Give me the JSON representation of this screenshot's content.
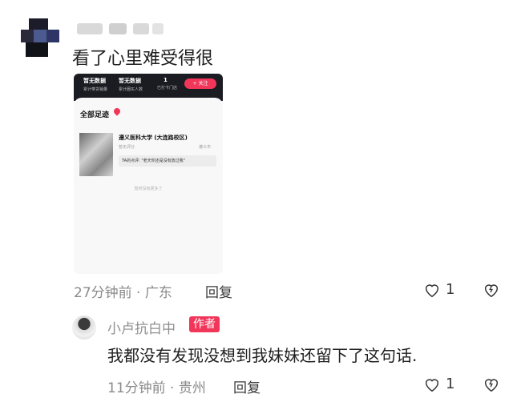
{
  "comment": {
    "text": "看了心里难受得很",
    "time_location": "27分钟前 · 广东",
    "reply_label": "回复",
    "like_count": "1"
  },
  "screenshot": {
    "stats": [
      {
        "value": "暂无数据",
        "label": "累计带货销量"
      },
      {
        "value": "暂无数据",
        "label": "累计圈买人数"
      },
      {
        "value": "1",
        "label": "已打卡门店"
      }
    ],
    "follow_label": "+ 关注",
    "section_title": "全部足迹",
    "place_name": "遵义医科大学 (大连路校区)",
    "place_score": "暂无评分",
    "place_city": "遵义市",
    "review": "TA的点评: \"老天你还是没有放过我\"",
    "no_more": "暂时没有更多了"
  },
  "reply": {
    "author": "小卢抗白中",
    "badge": "作者",
    "text": "我都没有发现没想到我妹妹还留下了这句话.",
    "time_location": "11分钟前 · 贵州",
    "reply_label": "回复",
    "like_count": "1"
  },
  "colors": {
    "accent": "#f1365a",
    "meta_gray": "#8a8a8a"
  }
}
